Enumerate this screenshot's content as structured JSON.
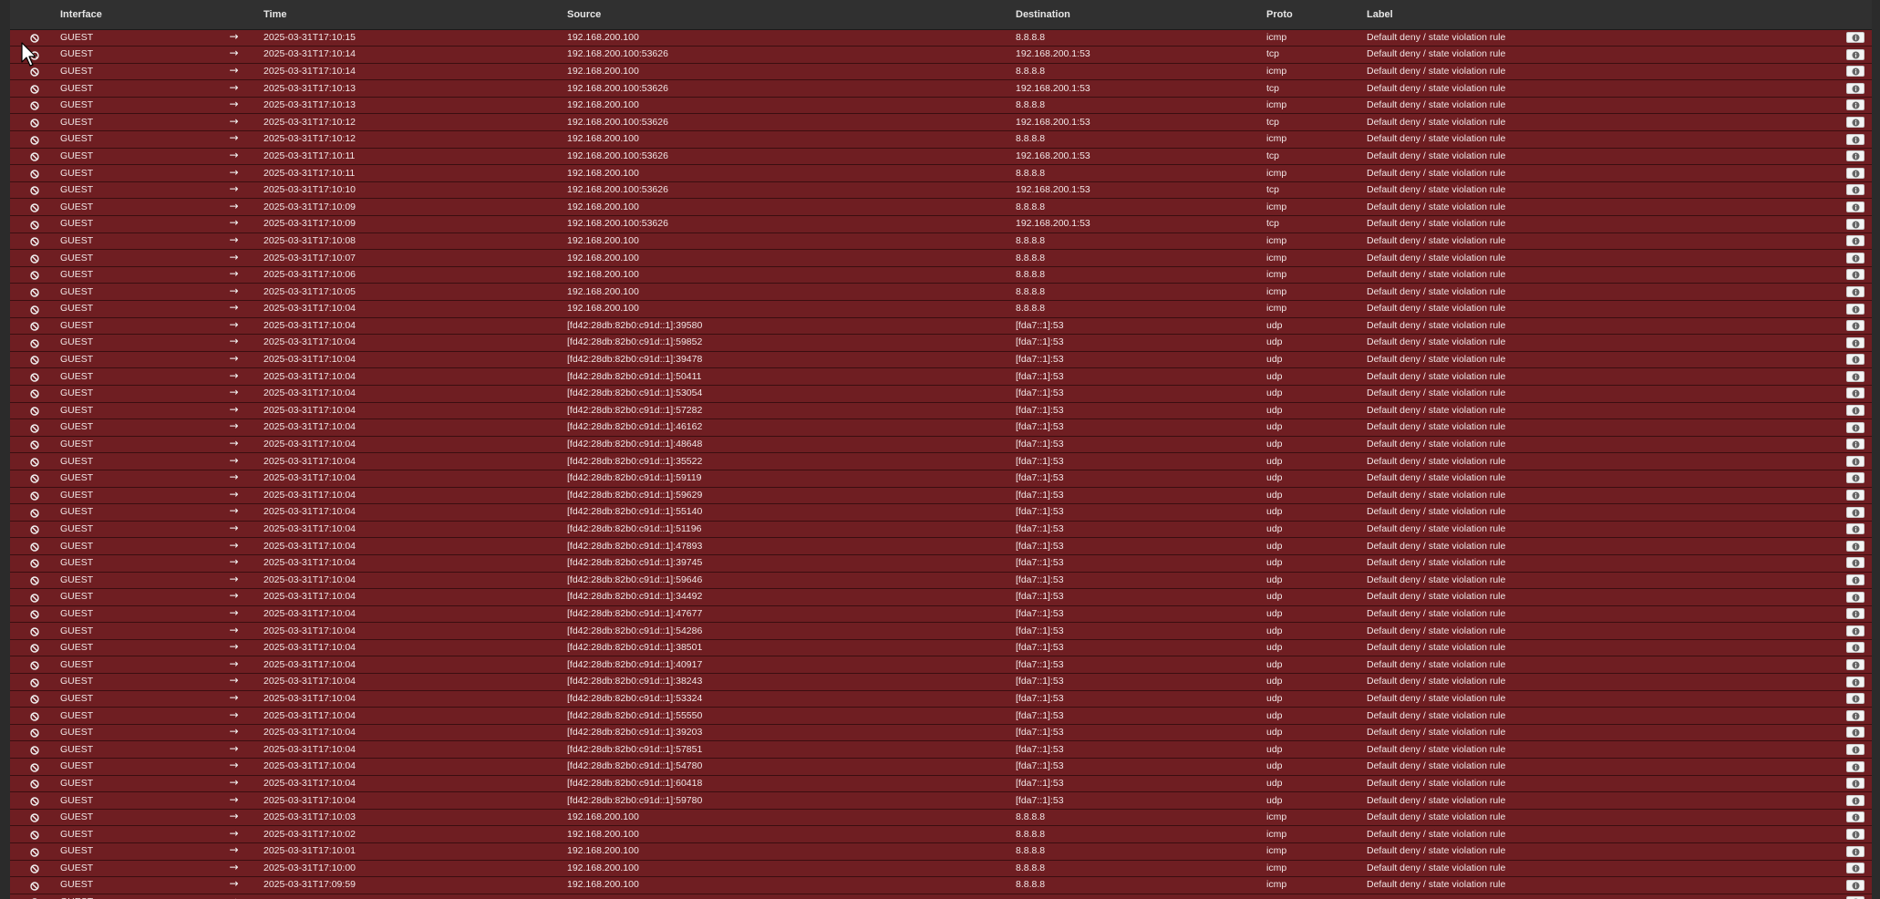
{
  "columns": {
    "status": "",
    "interface": "Interface",
    "dir": "",
    "time": "Time",
    "source": "Source",
    "destination": "Destination",
    "proto": "Proto",
    "label": "Label",
    "actions": ""
  },
  "colors": {
    "row_block": "#6f1e22",
    "header_bg": "#303030",
    "page_bg": "#2b2b2b"
  },
  "icons": {
    "status": "block-icon",
    "direction": "arrow-right-icon",
    "action": "info-icon"
  },
  "rows": [
    {
      "interface": "GUEST",
      "dir": "→",
      "time": "2025-03-31T17:10:15",
      "source": "192.168.200.100",
      "destination": "8.8.8.8",
      "proto": "icmp",
      "label": "Default deny / state violation rule"
    },
    {
      "interface": "GUEST",
      "dir": "→",
      "time": "2025-03-31T17:10:14",
      "source": "192.168.200.100:53626",
      "destination": "192.168.200.1:53",
      "proto": "tcp",
      "label": "Default deny / state violation rule"
    },
    {
      "interface": "GUEST",
      "dir": "→",
      "time": "2025-03-31T17:10:14",
      "source": "192.168.200.100",
      "destination": "8.8.8.8",
      "proto": "icmp",
      "label": "Default deny / state violation rule"
    },
    {
      "interface": "GUEST",
      "dir": "→",
      "time": "2025-03-31T17:10:13",
      "source": "192.168.200.100:53626",
      "destination": "192.168.200.1:53",
      "proto": "tcp",
      "label": "Default deny / state violation rule"
    },
    {
      "interface": "GUEST",
      "dir": "→",
      "time": "2025-03-31T17:10:13",
      "source": "192.168.200.100",
      "destination": "8.8.8.8",
      "proto": "icmp",
      "label": "Default deny / state violation rule"
    },
    {
      "interface": "GUEST",
      "dir": "→",
      "time": "2025-03-31T17:10:12",
      "source": "192.168.200.100:53626",
      "destination": "192.168.200.1:53",
      "proto": "tcp",
      "label": "Default deny / state violation rule"
    },
    {
      "interface": "GUEST",
      "dir": "→",
      "time": "2025-03-31T17:10:12",
      "source": "192.168.200.100",
      "destination": "8.8.8.8",
      "proto": "icmp",
      "label": "Default deny / state violation rule"
    },
    {
      "interface": "GUEST",
      "dir": "→",
      "time": "2025-03-31T17:10:11",
      "source": "192.168.200.100:53626",
      "destination": "192.168.200.1:53",
      "proto": "tcp",
      "label": "Default deny / state violation rule"
    },
    {
      "interface": "GUEST",
      "dir": "→",
      "time": "2025-03-31T17:10:11",
      "source": "192.168.200.100",
      "destination": "8.8.8.8",
      "proto": "icmp",
      "label": "Default deny / state violation rule"
    },
    {
      "interface": "GUEST",
      "dir": "→",
      "time": "2025-03-31T17:10:10",
      "source": "192.168.200.100:53626",
      "destination": "192.168.200.1:53",
      "proto": "tcp",
      "label": "Default deny / state violation rule"
    },
    {
      "interface": "GUEST",
      "dir": "→",
      "time": "2025-03-31T17:10:09",
      "source": "192.168.200.100",
      "destination": "8.8.8.8",
      "proto": "icmp",
      "label": "Default deny / state violation rule"
    },
    {
      "interface": "GUEST",
      "dir": "→",
      "time": "2025-03-31T17:10:09",
      "source": "192.168.200.100:53626",
      "destination": "192.168.200.1:53",
      "proto": "tcp",
      "label": "Default deny / state violation rule"
    },
    {
      "interface": "GUEST",
      "dir": "→",
      "time": "2025-03-31T17:10:08",
      "source": "192.168.200.100",
      "destination": "8.8.8.8",
      "proto": "icmp",
      "label": "Default deny / state violation rule"
    },
    {
      "interface": "GUEST",
      "dir": "→",
      "time": "2025-03-31T17:10:07",
      "source": "192.168.200.100",
      "destination": "8.8.8.8",
      "proto": "icmp",
      "label": "Default deny / state violation rule"
    },
    {
      "interface": "GUEST",
      "dir": "→",
      "time": "2025-03-31T17:10:06",
      "source": "192.168.200.100",
      "destination": "8.8.8.8",
      "proto": "icmp",
      "label": "Default deny / state violation rule"
    },
    {
      "interface": "GUEST",
      "dir": "→",
      "time": "2025-03-31T17:10:05",
      "source": "192.168.200.100",
      "destination": "8.8.8.8",
      "proto": "icmp",
      "label": "Default deny / state violation rule"
    },
    {
      "interface": "GUEST",
      "dir": "→",
      "time": "2025-03-31T17:10:04",
      "source": "192.168.200.100",
      "destination": "8.8.8.8",
      "proto": "icmp",
      "label": "Default deny / state violation rule"
    },
    {
      "interface": "GUEST",
      "dir": "→",
      "time": "2025-03-31T17:10:04",
      "source": "[fd42:28db:82b0:c91d::1]:39580",
      "destination": "[fda7::1]:53",
      "proto": "udp",
      "label": "Default deny / state violation rule"
    },
    {
      "interface": "GUEST",
      "dir": "→",
      "time": "2025-03-31T17:10:04",
      "source": "[fd42:28db:82b0:c91d::1]:59852",
      "destination": "[fda7::1]:53",
      "proto": "udp",
      "label": "Default deny / state violation rule"
    },
    {
      "interface": "GUEST",
      "dir": "→",
      "time": "2025-03-31T17:10:04",
      "source": "[fd42:28db:82b0:c91d::1]:39478",
      "destination": "[fda7::1]:53",
      "proto": "udp",
      "label": "Default deny / state violation rule"
    },
    {
      "interface": "GUEST",
      "dir": "→",
      "time": "2025-03-31T17:10:04",
      "source": "[fd42:28db:82b0:c91d::1]:50411",
      "destination": "[fda7::1]:53",
      "proto": "udp",
      "label": "Default deny / state violation rule"
    },
    {
      "interface": "GUEST",
      "dir": "→",
      "time": "2025-03-31T17:10:04",
      "source": "[fd42:28db:82b0:c91d::1]:53054",
      "destination": "[fda7::1]:53",
      "proto": "udp",
      "label": "Default deny / state violation rule"
    },
    {
      "interface": "GUEST",
      "dir": "→",
      "time": "2025-03-31T17:10:04",
      "source": "[fd42:28db:82b0:c91d::1]:57282",
      "destination": "[fda7::1]:53",
      "proto": "udp",
      "label": "Default deny / state violation rule"
    },
    {
      "interface": "GUEST",
      "dir": "→",
      "time": "2025-03-31T17:10:04",
      "source": "[fd42:28db:82b0:c91d::1]:46162",
      "destination": "[fda7::1]:53",
      "proto": "udp",
      "label": "Default deny / state violation rule"
    },
    {
      "interface": "GUEST",
      "dir": "→",
      "time": "2025-03-31T17:10:04",
      "source": "[fd42:28db:82b0:c91d::1]:48648",
      "destination": "[fda7::1]:53",
      "proto": "udp",
      "label": "Default deny / state violation rule"
    },
    {
      "interface": "GUEST",
      "dir": "→",
      "time": "2025-03-31T17:10:04",
      "source": "[fd42:28db:82b0:c91d::1]:35522",
      "destination": "[fda7::1]:53",
      "proto": "udp",
      "label": "Default deny / state violation rule"
    },
    {
      "interface": "GUEST",
      "dir": "→",
      "time": "2025-03-31T17:10:04",
      "source": "[fd42:28db:82b0:c91d::1]:59119",
      "destination": "[fda7::1]:53",
      "proto": "udp",
      "label": "Default deny / state violation rule"
    },
    {
      "interface": "GUEST",
      "dir": "→",
      "time": "2025-03-31T17:10:04",
      "source": "[fd42:28db:82b0:c91d::1]:59629",
      "destination": "[fda7::1]:53",
      "proto": "udp",
      "label": "Default deny / state violation rule"
    },
    {
      "interface": "GUEST",
      "dir": "→",
      "time": "2025-03-31T17:10:04",
      "source": "[fd42:28db:82b0:c91d::1]:55140",
      "destination": "[fda7::1]:53",
      "proto": "udp",
      "label": "Default deny / state violation rule"
    },
    {
      "interface": "GUEST",
      "dir": "→",
      "time": "2025-03-31T17:10:04",
      "source": "[fd42:28db:82b0:c91d::1]:51196",
      "destination": "[fda7::1]:53",
      "proto": "udp",
      "label": "Default deny / state violation rule"
    },
    {
      "interface": "GUEST",
      "dir": "→",
      "time": "2025-03-31T17:10:04",
      "source": "[fd42:28db:82b0:c91d::1]:47893",
      "destination": "[fda7::1]:53",
      "proto": "udp",
      "label": "Default deny / state violation rule"
    },
    {
      "interface": "GUEST",
      "dir": "→",
      "time": "2025-03-31T17:10:04",
      "source": "[fd42:28db:82b0:c91d::1]:39745",
      "destination": "[fda7::1]:53",
      "proto": "udp",
      "label": "Default deny / state violation rule"
    },
    {
      "interface": "GUEST",
      "dir": "→",
      "time": "2025-03-31T17:10:04",
      "source": "[fd42:28db:82b0:c91d::1]:59646",
      "destination": "[fda7::1]:53",
      "proto": "udp",
      "label": "Default deny / state violation rule"
    },
    {
      "interface": "GUEST",
      "dir": "→",
      "time": "2025-03-31T17:10:04",
      "source": "[fd42:28db:82b0:c91d::1]:34492",
      "destination": "[fda7::1]:53",
      "proto": "udp",
      "label": "Default deny / state violation rule"
    },
    {
      "interface": "GUEST",
      "dir": "→",
      "time": "2025-03-31T17:10:04",
      "source": "[fd42:28db:82b0:c91d::1]:47677",
      "destination": "[fda7::1]:53",
      "proto": "udp",
      "label": "Default deny / state violation rule"
    },
    {
      "interface": "GUEST",
      "dir": "→",
      "time": "2025-03-31T17:10:04",
      "source": "[fd42:28db:82b0:c91d::1]:54286",
      "destination": "[fda7::1]:53",
      "proto": "udp",
      "label": "Default deny / state violation rule"
    },
    {
      "interface": "GUEST",
      "dir": "→",
      "time": "2025-03-31T17:10:04",
      "source": "[fd42:28db:82b0:c91d::1]:38501",
      "destination": "[fda7::1]:53",
      "proto": "udp",
      "label": "Default deny / state violation rule"
    },
    {
      "interface": "GUEST",
      "dir": "→",
      "time": "2025-03-31T17:10:04",
      "source": "[fd42:28db:82b0:c91d::1]:40917",
      "destination": "[fda7::1]:53",
      "proto": "udp",
      "label": "Default deny / state violation rule"
    },
    {
      "interface": "GUEST",
      "dir": "→",
      "time": "2025-03-31T17:10:04",
      "source": "[fd42:28db:82b0:c91d::1]:38243",
      "destination": "[fda7::1]:53",
      "proto": "udp",
      "label": "Default deny / state violation rule"
    },
    {
      "interface": "GUEST",
      "dir": "→",
      "time": "2025-03-31T17:10:04",
      "source": "[fd42:28db:82b0:c91d::1]:53324",
      "destination": "[fda7::1]:53",
      "proto": "udp",
      "label": "Default deny / state violation rule"
    },
    {
      "interface": "GUEST",
      "dir": "→",
      "time": "2025-03-31T17:10:04",
      "source": "[fd42:28db:82b0:c91d::1]:55550",
      "destination": "[fda7::1]:53",
      "proto": "udp",
      "label": "Default deny / state violation rule"
    },
    {
      "interface": "GUEST",
      "dir": "→",
      "time": "2025-03-31T17:10:04",
      "source": "[fd42:28db:82b0:c91d::1]:39203",
      "destination": "[fda7::1]:53",
      "proto": "udp",
      "label": "Default deny / state violation rule"
    },
    {
      "interface": "GUEST",
      "dir": "→",
      "time": "2025-03-31T17:10:04",
      "source": "[fd42:28db:82b0:c91d::1]:57851",
      "destination": "[fda7::1]:53",
      "proto": "udp",
      "label": "Default deny / state violation rule"
    },
    {
      "interface": "GUEST",
      "dir": "→",
      "time": "2025-03-31T17:10:04",
      "source": "[fd42:28db:82b0:c91d::1]:54780",
      "destination": "[fda7::1]:53",
      "proto": "udp",
      "label": "Default deny / state violation rule"
    },
    {
      "interface": "GUEST",
      "dir": "→",
      "time": "2025-03-31T17:10:04",
      "source": "[fd42:28db:82b0:c91d::1]:60418",
      "destination": "[fda7::1]:53",
      "proto": "udp",
      "label": "Default deny / state violation rule"
    },
    {
      "interface": "GUEST",
      "dir": "→",
      "time": "2025-03-31T17:10:04",
      "source": "[fd42:28db:82b0:c91d::1]:59780",
      "destination": "[fda7::1]:53",
      "proto": "udp",
      "label": "Default deny / state violation rule"
    },
    {
      "interface": "GUEST",
      "dir": "→",
      "time": "2025-03-31T17:10:03",
      "source": "192.168.200.100",
      "destination": "8.8.8.8",
      "proto": "icmp",
      "label": "Default deny / state violation rule"
    },
    {
      "interface": "GUEST",
      "dir": "→",
      "time": "2025-03-31T17:10:02",
      "source": "192.168.200.100",
      "destination": "8.8.8.8",
      "proto": "icmp",
      "label": "Default deny / state violation rule"
    },
    {
      "interface": "GUEST",
      "dir": "→",
      "time": "2025-03-31T17:10:01",
      "source": "192.168.200.100",
      "destination": "8.8.8.8",
      "proto": "icmp",
      "label": "Default deny / state violation rule"
    },
    {
      "interface": "GUEST",
      "dir": "→",
      "time": "2025-03-31T17:10:00",
      "source": "192.168.200.100",
      "destination": "8.8.8.8",
      "proto": "icmp",
      "label": "Default deny / state violation rule"
    },
    {
      "interface": "GUEST",
      "dir": "→",
      "time": "2025-03-31T17:09:59",
      "source": "192.168.200.100",
      "destination": "8.8.8.8",
      "proto": "icmp",
      "label": "Default deny / state violation rule"
    },
    {
      "interface": "GUEST",
      "dir": "→",
      "time": "",
      "source": "",
      "destination": "",
      "proto": "",
      "label": ""
    }
  ]
}
